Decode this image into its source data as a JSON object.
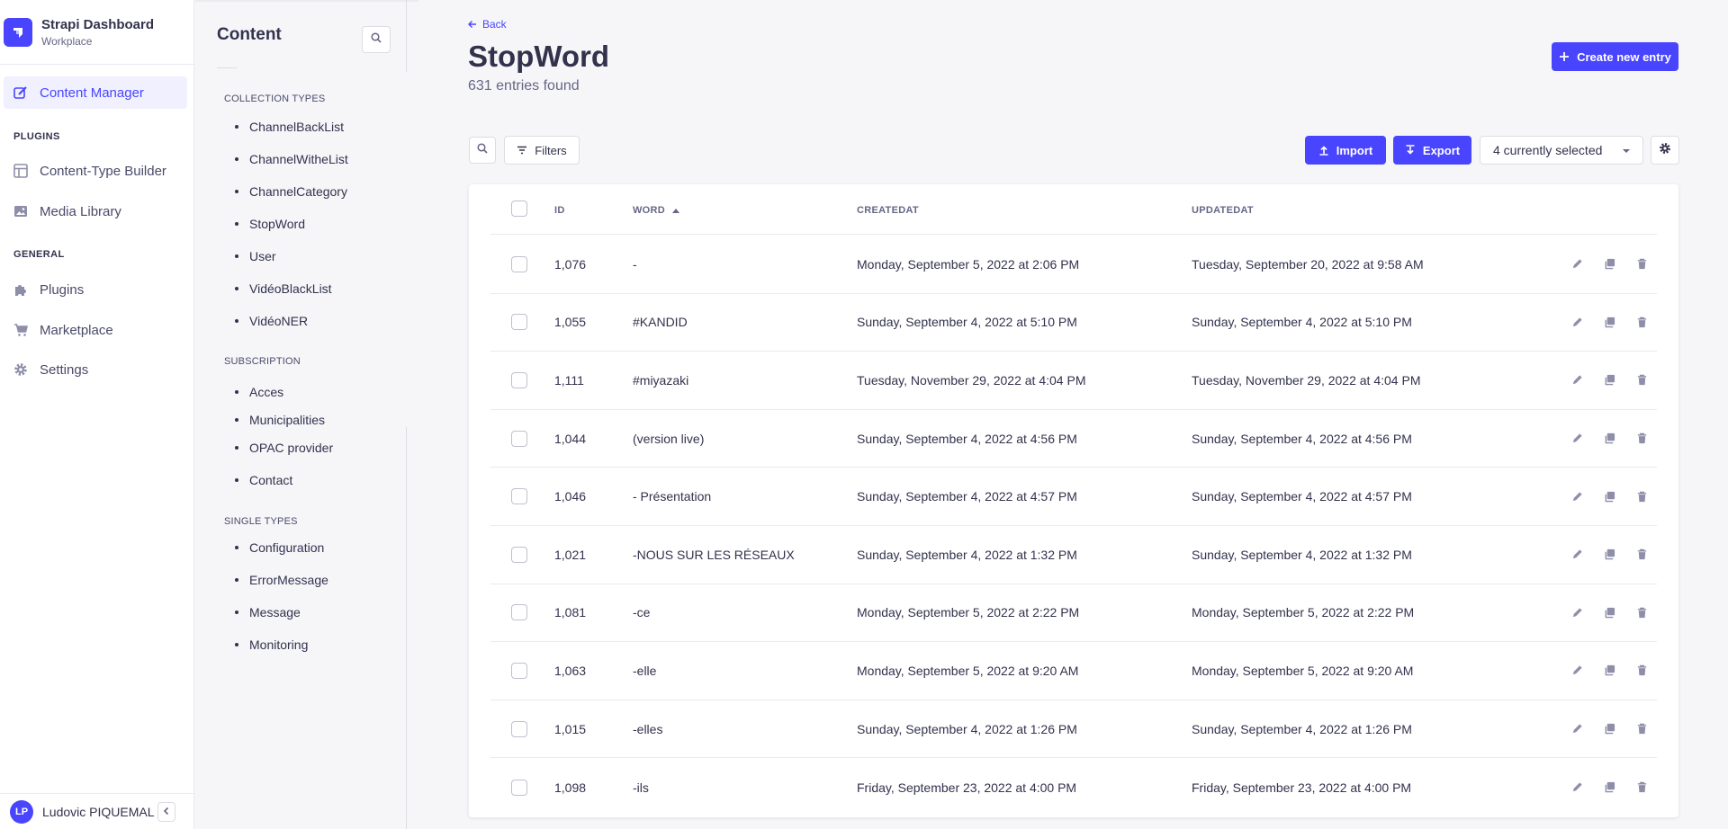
{
  "brand": {
    "title": "Strapi Dashboard",
    "subtitle": "Workplace"
  },
  "nav": {
    "content_manager": "Content Manager",
    "plugins_section": "PLUGINS",
    "content_type_builder": "Content-Type Builder",
    "media_library": "Media Library",
    "general_section": "GENERAL",
    "plugins": "Plugins",
    "marketplace": "Marketplace",
    "settings": "Settings"
  },
  "user": {
    "initials": "LP",
    "name": "Ludovic PIQUEMAL"
  },
  "subnav": {
    "title": "Content",
    "collection_types_label": "COLLECTION TYPES",
    "collection_types": [
      "ChannelBackList",
      "ChannelWitheList",
      "ChannelCategory",
      "StopWord",
      "User",
      "VidéoBlackList",
      "VidéoNER"
    ],
    "subscription_label": "SUBSCRIPTION",
    "subscription": [
      "Acces",
      "Municipalities",
      "OPAC provider",
      "Contact"
    ],
    "single_types_label": "SINGLE TYPES",
    "single_types": [
      "Configuration",
      "ErrorMessage",
      "Message",
      "Monitoring"
    ]
  },
  "header": {
    "back": "Back",
    "title": "StopWord",
    "subtitle": "631 entries found",
    "create_button": "Create new entry"
  },
  "toolbar": {
    "filters": "Filters",
    "import": "Import",
    "export": "Export",
    "columns_select": "4 currently selected"
  },
  "table": {
    "columns": [
      "ID",
      "WORD",
      "CREATEDAT",
      "UPDATEDAT"
    ],
    "sorted_column": "WORD",
    "rows": [
      {
        "id": "1,076",
        "word": "-",
        "created": "Monday, September 5, 2022 at 2:06 PM",
        "updated": "Tuesday, September 20, 2022 at 9:58 AM"
      },
      {
        "id": "1,055",
        "word": "#KANDID",
        "created": "Sunday, September 4, 2022 at 5:10 PM",
        "updated": "Sunday, September 4, 2022 at 5:10 PM"
      },
      {
        "id": "1,111",
        "word": "#miyazaki",
        "created": "Tuesday, November 29, 2022 at 4:04 PM",
        "updated": "Tuesday, November 29, 2022 at 4:04 PM"
      },
      {
        "id": "1,044",
        "word": "(version live)",
        "created": "Sunday, September 4, 2022 at 4:56 PM",
        "updated": "Sunday, September 4, 2022 at 4:56 PM"
      },
      {
        "id": "1,046",
        "word": "- Présentation",
        "created": "Sunday, September 4, 2022 at 4:57 PM",
        "updated": "Sunday, September 4, 2022 at 4:57 PM"
      },
      {
        "id": "1,021",
        "word": "-NOUS SUR LES RÉSEAUX",
        "created": "Sunday, September 4, 2022 at 1:32 PM",
        "updated": "Sunday, September 4, 2022 at 1:32 PM"
      },
      {
        "id": "1,081",
        "word": "-ce",
        "created": "Monday, September 5, 2022 at 2:22 PM",
        "updated": "Monday, September 5, 2022 at 2:22 PM"
      },
      {
        "id": "1,063",
        "word": "-elle",
        "created": "Monday, September 5, 2022 at 9:20 AM",
        "updated": "Monday, September 5, 2022 at 9:20 AM"
      },
      {
        "id": "1,015",
        "word": "-elles",
        "created": "Sunday, September 4, 2022 at 1:26 PM",
        "updated": "Sunday, September 4, 2022 at 1:26 PM"
      },
      {
        "id": "1,098",
        "word": "-ils",
        "created": "Friday, September 23, 2022 at 4:00 PM",
        "updated": "Friday, September 23, 2022 at 4:00 PM"
      }
    ]
  },
  "colors": {
    "accent": "#4945ff",
    "text": "#32324d",
    "muted": "#666687",
    "background": "#f6f6f9"
  },
  "icons": {
    "brand": "strapi-logo-icon",
    "content_manager": "feather-pen-icon",
    "content_type_builder": "layout-icon",
    "media_library": "image-icon",
    "plugins": "puzzle-icon",
    "marketplace": "cart-icon",
    "settings": "gear-icon",
    "search": "search-icon",
    "filters": "filter-icon",
    "import": "upload-icon",
    "export": "download-icon",
    "edit": "pencil-icon",
    "duplicate": "duplicate-icon",
    "delete": "trash-icon"
  }
}
